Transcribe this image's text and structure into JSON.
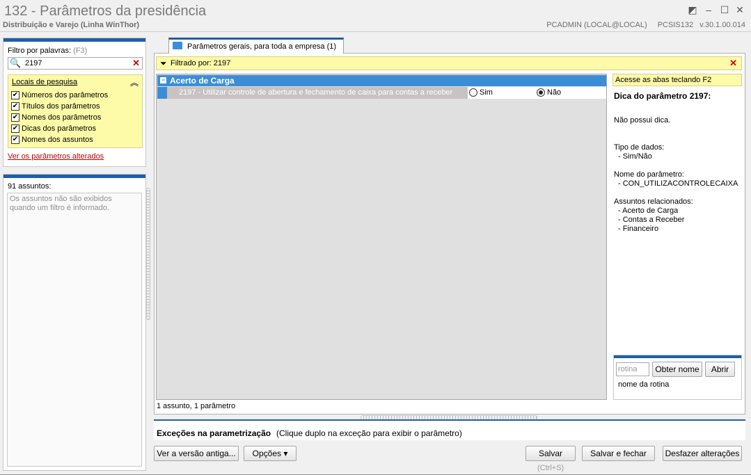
{
  "window": {
    "title": "132 - Parâmetros da presidência",
    "subtitle": "Distribuição e Varejo (Linha WinThor)",
    "user": "PCADMIN (LOCAL@LOCAL)",
    "module": "PCSIS132",
    "version": "v.30.1.00.014"
  },
  "filter": {
    "label": "Filtro por palavras:",
    "shortcut": "(F3)",
    "value": "2197",
    "locais_title": "Locais de pesquisa",
    "options": [
      {
        "label": "Números dos parâmetros",
        "checked": true
      },
      {
        "label": "Títulos dos parâmetros",
        "checked": true
      },
      {
        "label": "Nomes dos parâmetros",
        "checked": true
      },
      {
        "label": "Dicas dos parâmetros",
        "checked": true
      },
      {
        "label": "Nomes dos assuntos",
        "checked": true
      }
    ],
    "changed_link": "Ver os parâmetros alterados"
  },
  "assuntos": {
    "count": "91 assuntos:",
    "message": "Os assuntos não são exibidos quando um filtro é informado."
  },
  "tab": {
    "label": "Parâmetros gerais, para toda a empresa",
    "count": "(1)"
  },
  "filterbar": {
    "text": "Filtrado por: 2197"
  },
  "group": {
    "title": "Acerto de Carga"
  },
  "parameter": {
    "description": "2197 - Utilizar controle de abertura e fechamento de caixa para contas a receber",
    "option_yes": "Sim",
    "option_no": "Não",
    "selected": "Não"
  },
  "status": "1 assunto, 1 parâmetro",
  "info": {
    "hint": "Acesse as abas teclando F2",
    "title": "Dica do parâmetro 2197:",
    "no_tip": "Não possui dica.",
    "type_label": "Tipo de dados:",
    "type_value": "- Sim/Não",
    "name_label": "Nome do parâmetro:",
    "name_value": "- CON_UTILIZACONTROLECAIXA",
    "related_label": "Assuntos relacionados:",
    "related": [
      "- Acerto de Carga",
      "- Contas a Receber",
      "- Financeiro"
    ]
  },
  "rotina": {
    "placeholder": "rotina",
    "btn_name": "Obter nome",
    "btn_open": "Abrir",
    "caption": "nome da rotina"
  },
  "excecoes": {
    "title": "Exceções na parametrização",
    "hint": "(Clique duplo na exceção para exibir o parâmetro)"
  },
  "buttons": {
    "old_version": "Ver a versão antiga...",
    "options": "Opções ▾",
    "save": "Salvar",
    "save_shortcut": "(Ctrl+S)",
    "save_close": "Salvar e fechar",
    "undo": "Desfazer alterações"
  }
}
